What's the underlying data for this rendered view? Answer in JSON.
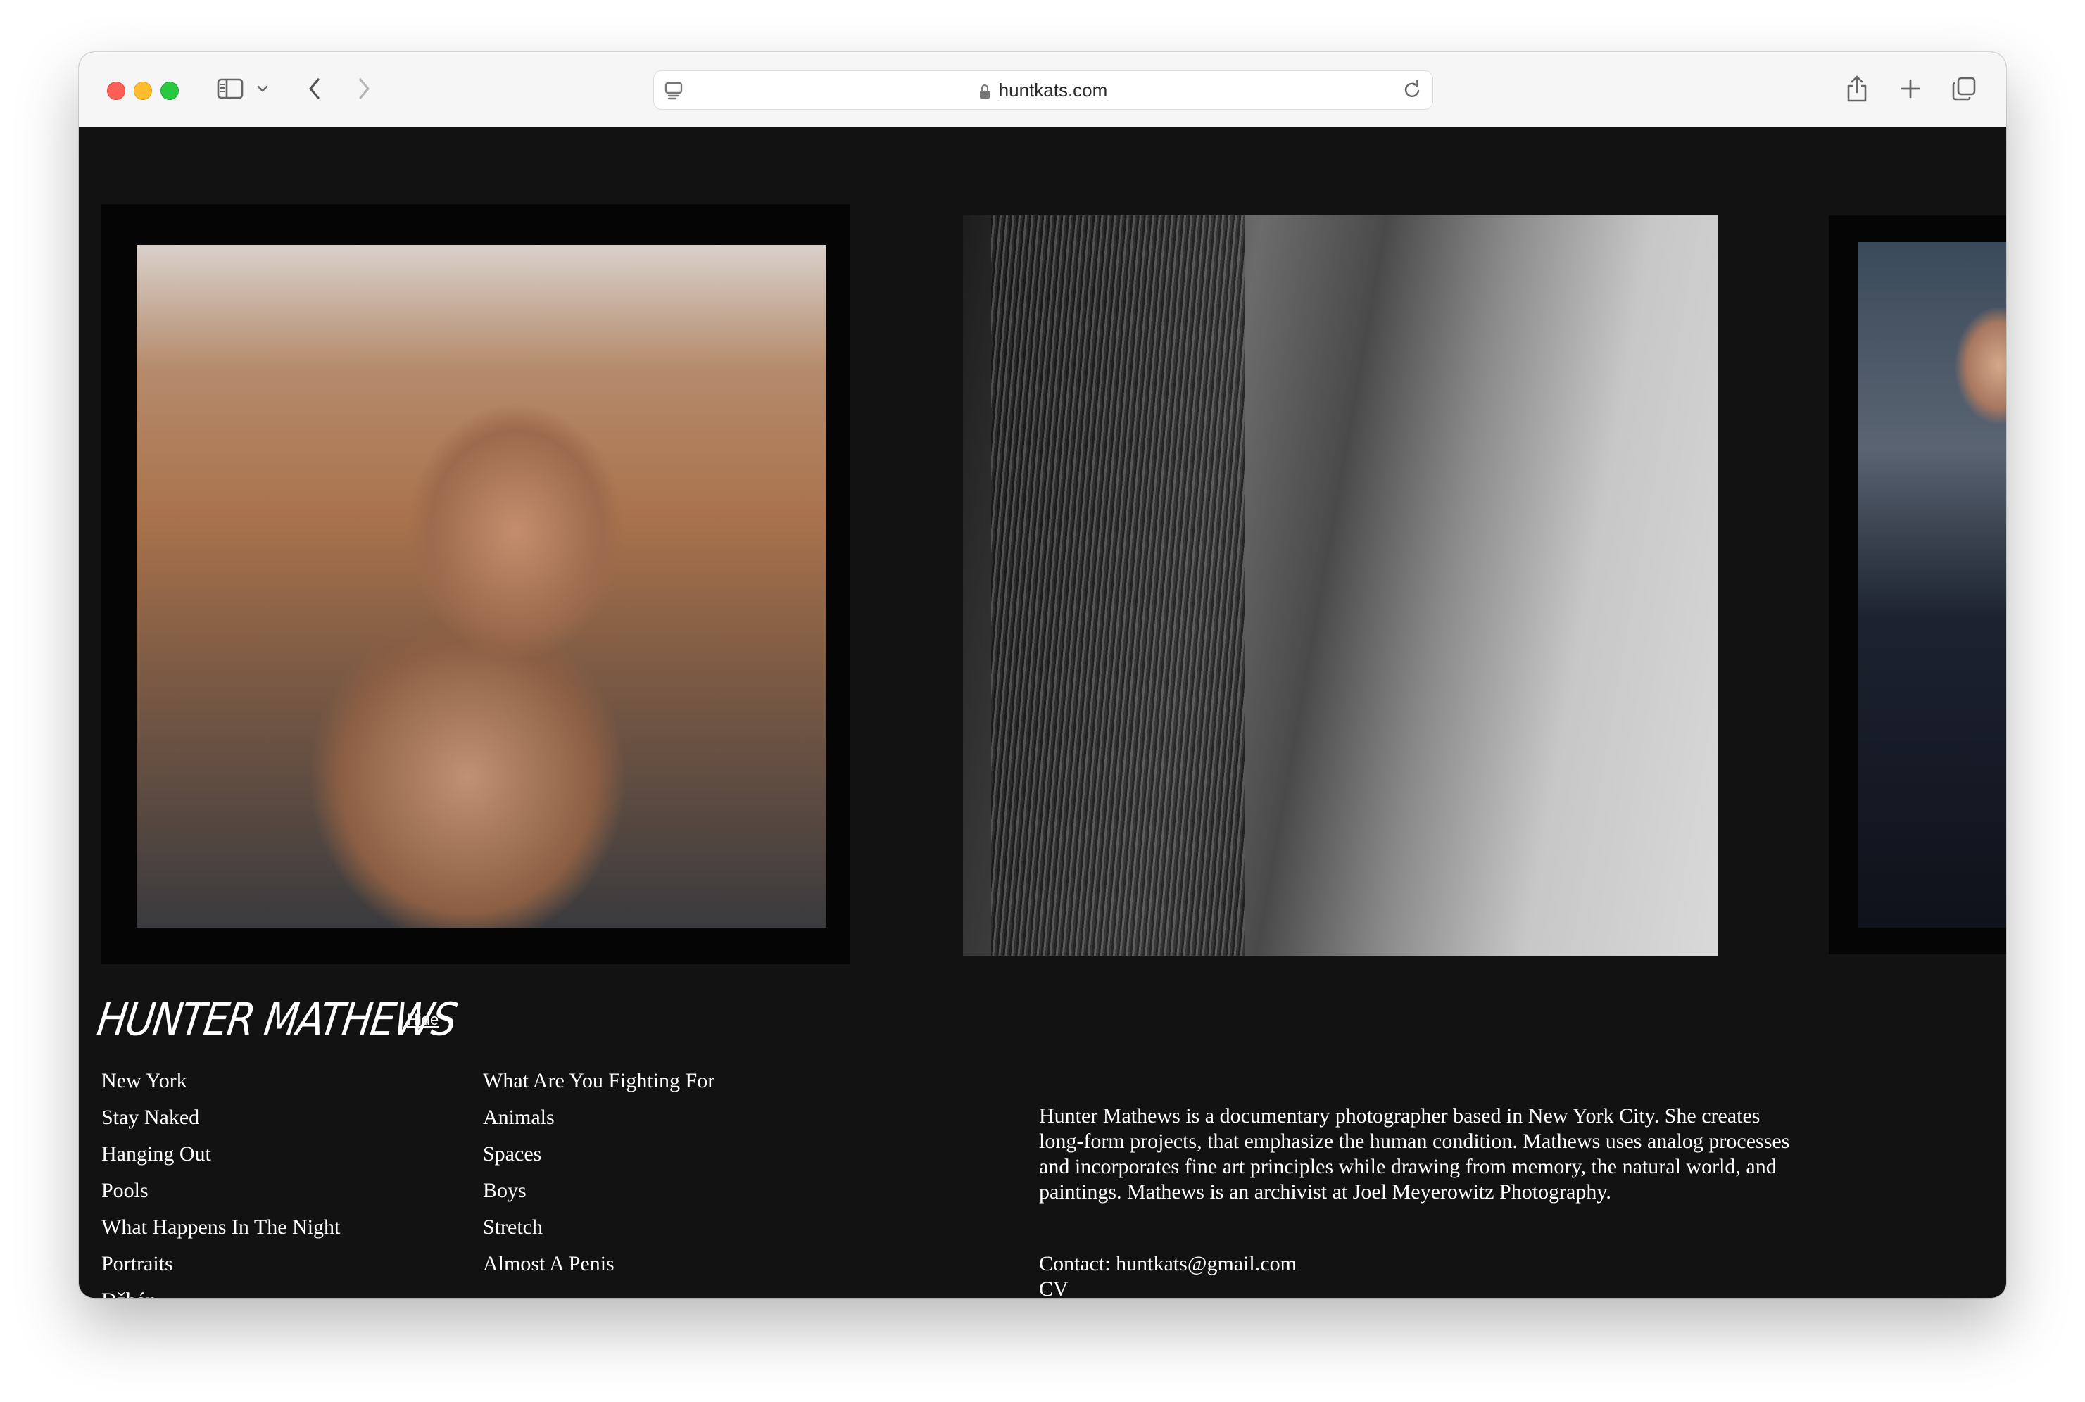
{
  "browser": {
    "url": "huntkats.com"
  },
  "site": {
    "logo_text": "HUNTER MATHEWS",
    "hide_label": "Hide",
    "nav_col1": [
      "New York",
      "Stay Naked",
      "Hanging Out",
      "Pools",
      "What Happens In The Night",
      "Portraits",
      "Džbán"
    ],
    "nav_col2": [
      "What Are You Fighting For",
      "Animals",
      "Spaces",
      "Boys",
      "Stretch",
      "Almost A Penis"
    ],
    "bio": "Hunter Mathews is a documentary photographer based in New York City. She creates long-form projects, that emphasize the human condition. Mathews uses analog processes and incorporates fine art principles while drawing from memory, the natural world, and paintings. Mathews is an archivist at Joel Meyerowitz Photography.",
    "contact_label": "Contact:",
    "contact_email": "huntkats@gmail.com",
    "cv_label": "CV"
  },
  "colors": {
    "page_background": "#121212",
    "text": "#ffffff",
    "toolbar_background": "#f6f6f6"
  }
}
